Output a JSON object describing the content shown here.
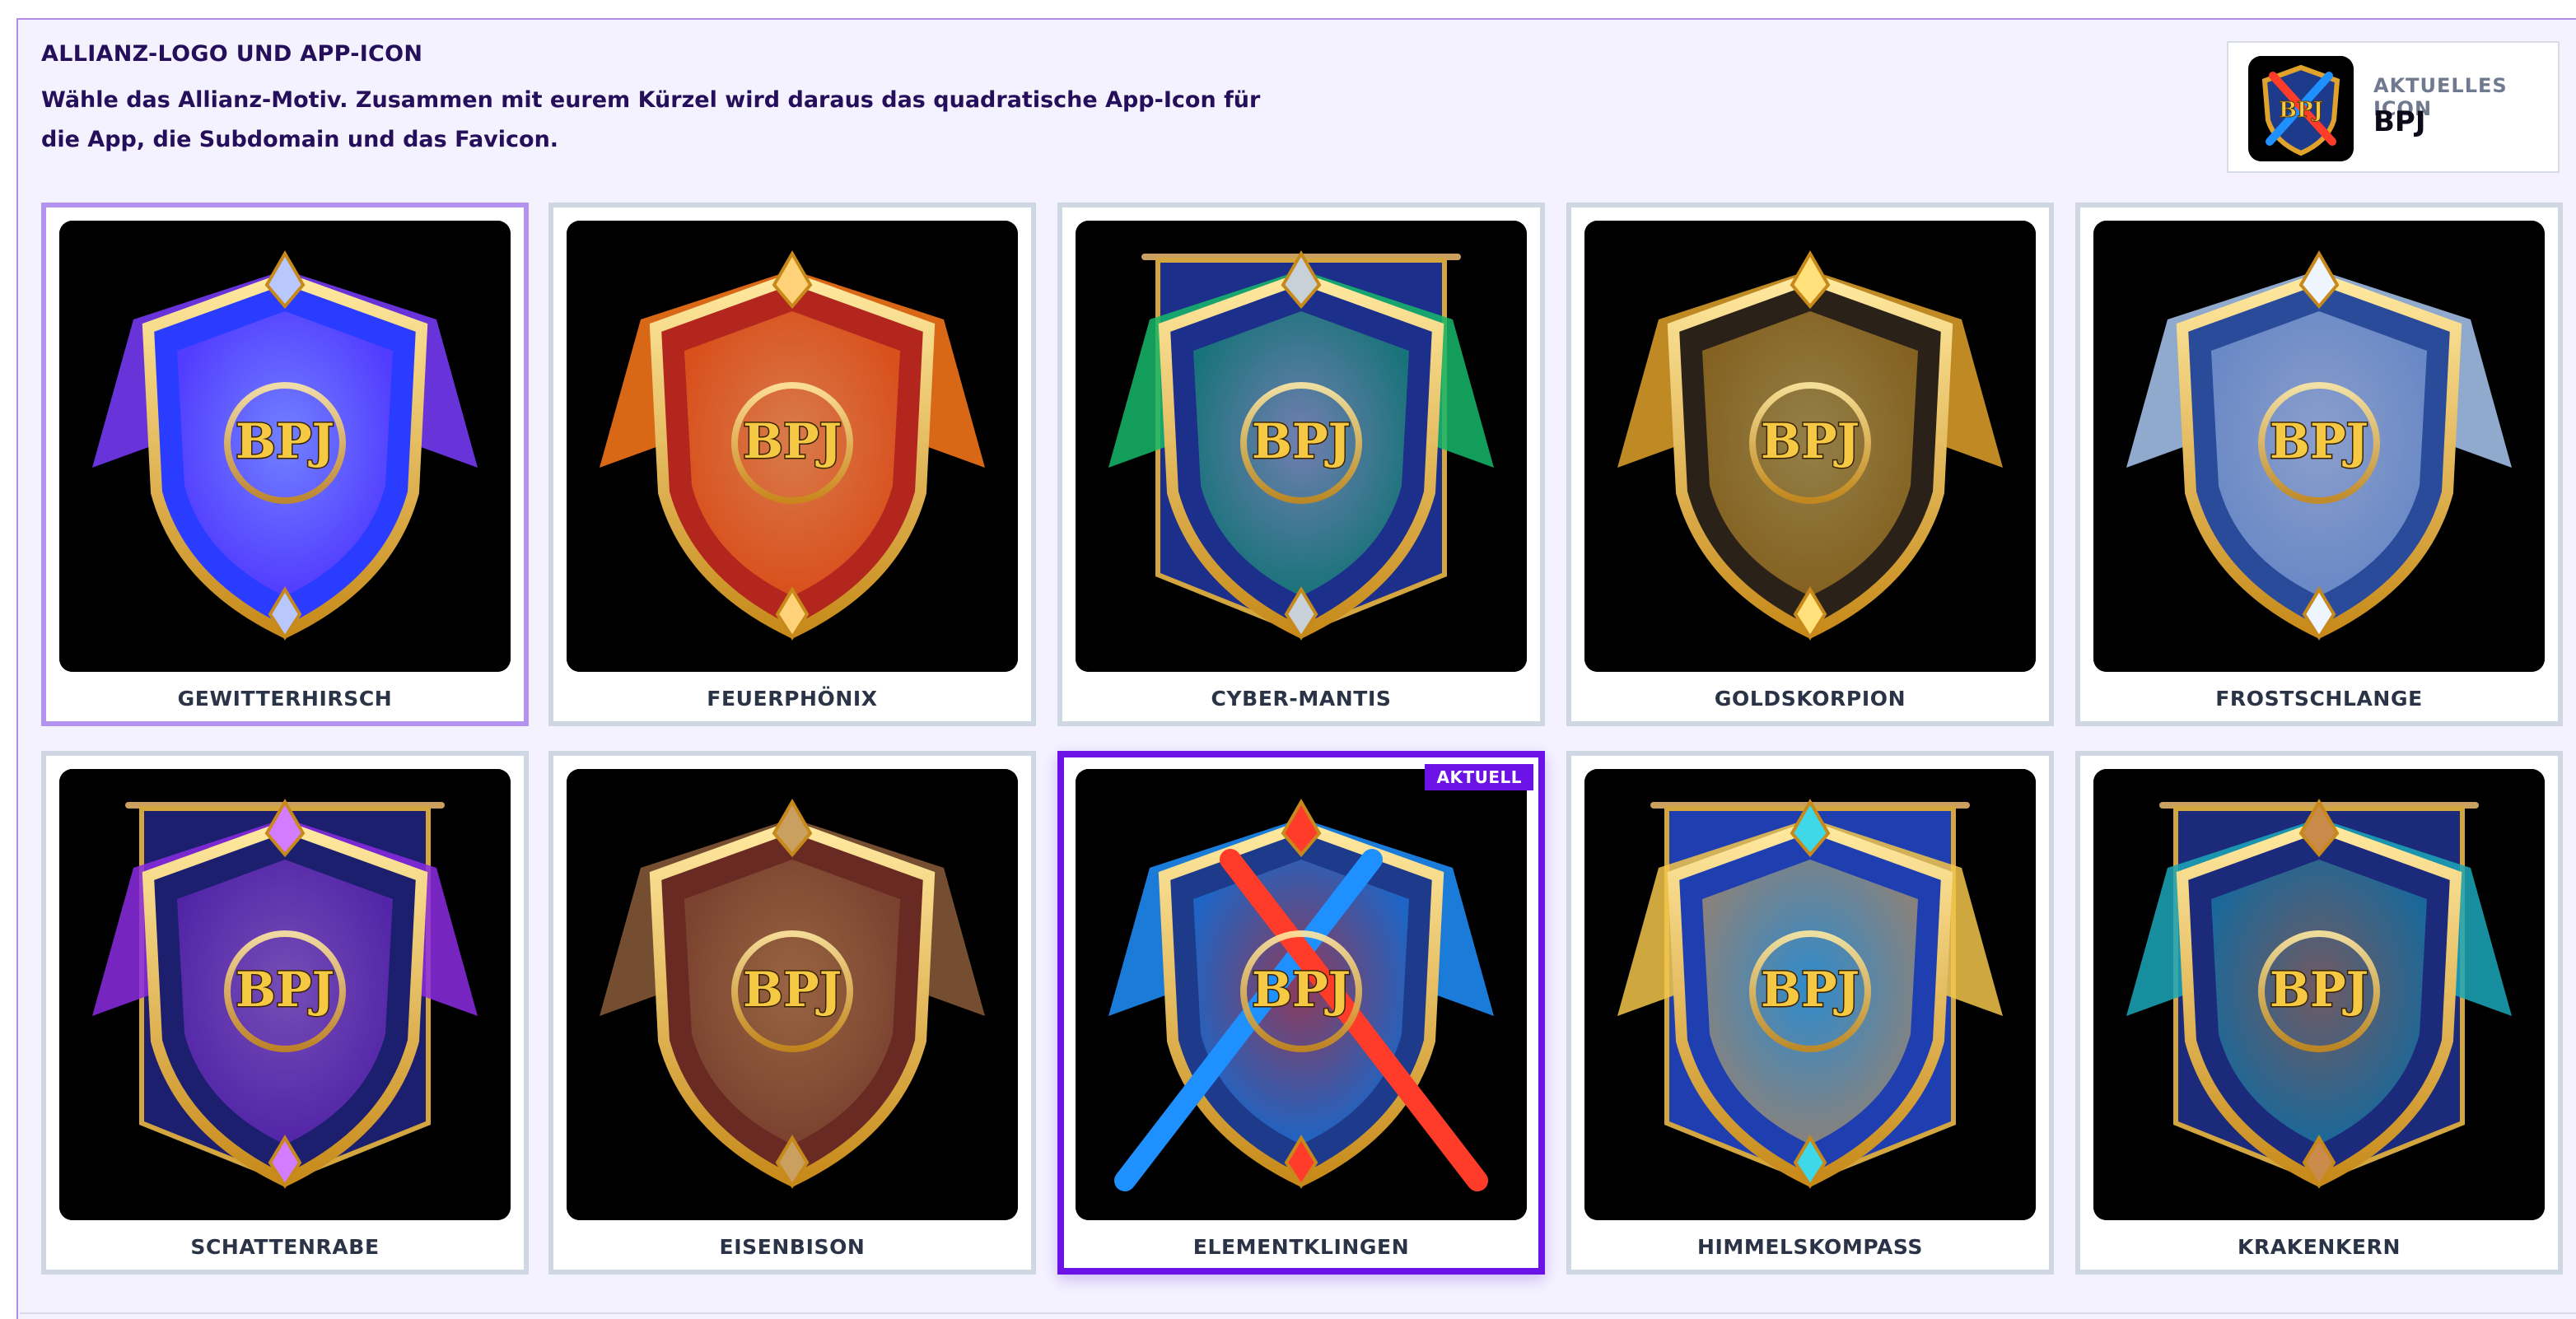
{
  "header": {
    "title": "ALLIANZ-LOGO UND APP-ICON",
    "description": "Wähle das Allianz-Motiv. Zusammen mit eurem Kürzel wird daraus das quadratische App-Icon für die App, die Subdomain und das Favicon."
  },
  "current_icon": {
    "label": "AKTUELLES ICON",
    "name": "BPJ"
  },
  "monogram": "BPJ",
  "badge_current": "AKTUELL",
  "motifs": [
    {
      "name": "GEWITTERHIRSCH",
      "icon": "thunder-stag-emblem-icon",
      "colors": [
        "#2a3cff",
        "#7a3cff",
        "#b9c7ff"
      ]
    },
    {
      "name": "FEUERPHÖNIX",
      "icon": "fire-phoenix-emblem-icon",
      "colors": [
        "#b3261e",
        "#ff7a1a",
        "#ffd27a"
      ]
    },
    {
      "name": "CYBER-MANTIS",
      "icon": "cyber-mantis-emblem-icon",
      "colors": [
        "#1c2f8a",
        "#16b86a",
        "#c8d0d8"
      ]
    },
    {
      "name": "GOLDSKORPION",
      "icon": "gold-scorpion-emblem-icon",
      "colors": [
        "#2a2218",
        "#e0a22a",
        "#ffe07a"
      ]
    },
    {
      "name": "FROSTSCHLANGE",
      "icon": "frost-serpent-emblem-icon",
      "colors": [
        "#2a4a9a",
        "#a9c8f2",
        "#eef5ff"
      ]
    },
    {
      "name": "SCHATTENRABE",
      "icon": "shadow-raven-emblem-icon",
      "colors": [
        "#1b1f6e",
        "#8b2be2",
        "#d27cff"
      ]
    },
    {
      "name": "EISENBISON",
      "icon": "iron-bison-emblem-icon",
      "colors": [
        "#6a2a24",
        "#8a5a3a",
        "#c9a060"
      ]
    },
    {
      "name": "ELEMENTKLINGEN",
      "icon": "element-blades-emblem-icon",
      "colors": [
        "#1e3a8a",
        "#1e90ff",
        "#ff3b2a"
      ]
    },
    {
      "name": "HIMMELSKOMPASS",
      "icon": "sky-compass-emblem-icon",
      "colors": [
        "#1f3fb0",
        "#f2c64a",
        "#3fd8e8"
      ]
    },
    {
      "name": "KRAKENKERN",
      "icon": "kraken-core-emblem-icon",
      "colors": [
        "#1b2a7a",
        "#1aa7b8",
        "#c98a4a"
      ]
    }
  ],
  "selection": {
    "hovered_index": 0,
    "current_index": 7
  }
}
